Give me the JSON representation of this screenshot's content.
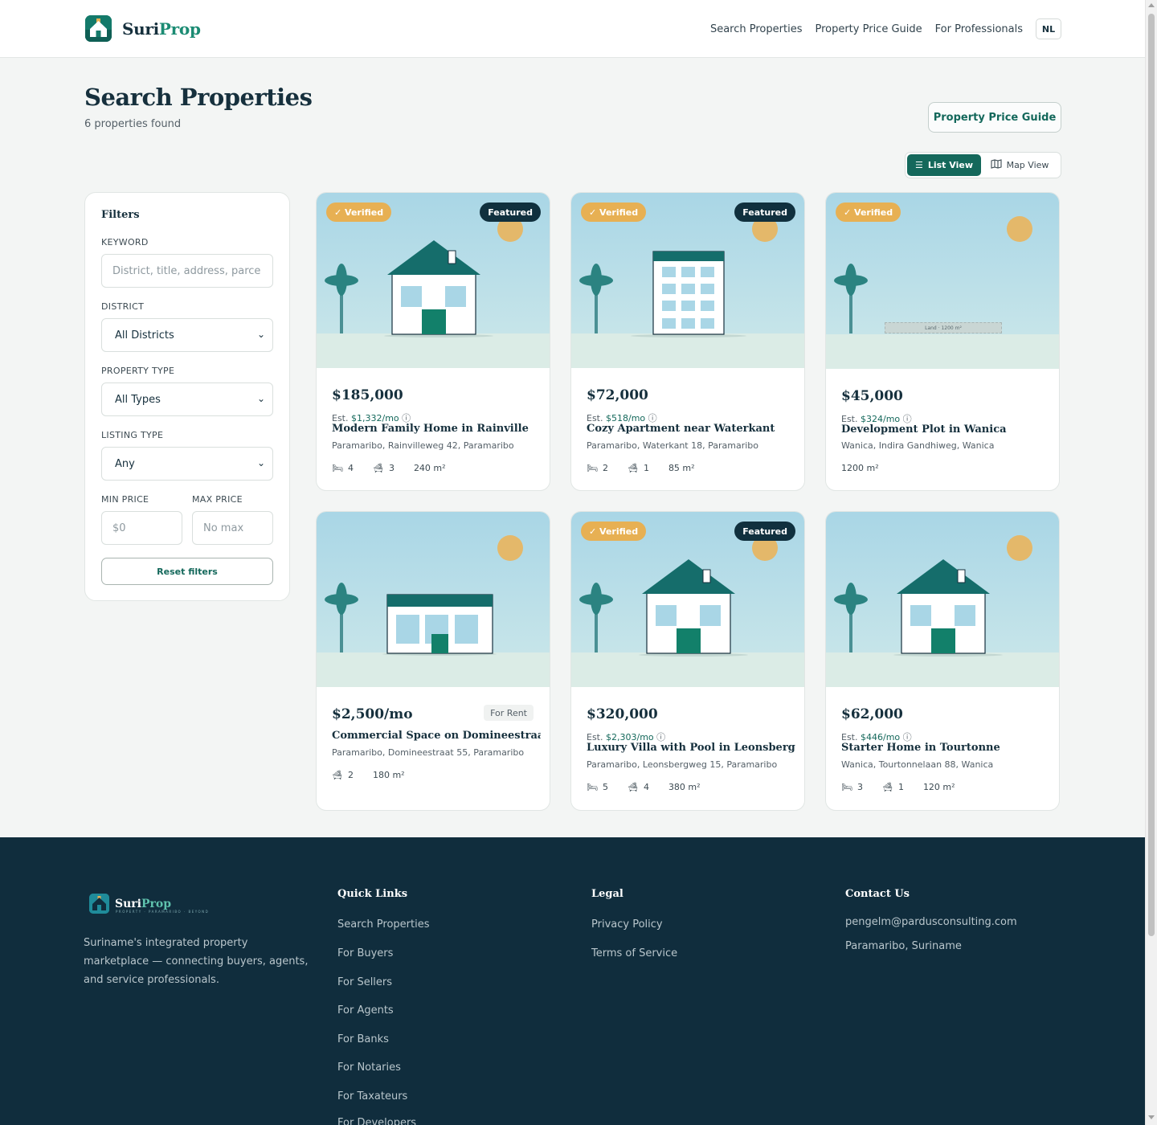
{
  "header": {
    "brand_part1": "Suri",
    "brand_part2": "Prop",
    "nav": [
      "Search Properties",
      "Property Price Guide",
      "For Professionals"
    ],
    "lang": "NL"
  },
  "page": {
    "title": "Search Properties",
    "count": "6 properties found",
    "guide_button": "Property Price Guide",
    "list_view": "List View",
    "map_view": "Map View"
  },
  "filters": {
    "title": "Filters",
    "keyword_label": "KEYWORD",
    "keyword_placeholder": "District, title, address, parce",
    "district_label": "DISTRICT",
    "district_value": "All Districts",
    "type_label": "PROPERTY TYPE",
    "type_value": "All Types",
    "listing_label": "LISTING TYPE",
    "listing_value": "Any",
    "min_label": "MIN PRICE",
    "min_placeholder": "$0",
    "max_label": "MAX PRICE",
    "max_placeholder": "No max",
    "reset": "Reset filters"
  },
  "badges": {
    "verified": "Verified",
    "featured": "Featured",
    "for_rent": "For Rent"
  },
  "est_prefix": "Est.",
  "cards": [
    {
      "price": "$185,000",
      "est": "$1,332/mo",
      "title": "Modern Family Home in Rainville",
      "address": "Paramaribo, Rainvilleweg 42, Paramaribo",
      "beds": "4",
      "baths": "3",
      "area": "240 m²"
    },
    {
      "price": "$72,000",
      "est": "$518/mo",
      "title": "Cozy Apartment near Waterkant",
      "address": "Paramaribo, Waterkant 18, Paramaribo",
      "beds": "2",
      "baths": "1",
      "area": "85 m²"
    },
    {
      "price": "$45,000",
      "est": "$324/mo",
      "title": "Development Plot in Wanica",
      "address": "Wanica, Indira Gandhiweg, Wanica",
      "area": "1200 m²",
      "land_label": "Land · 1200 m²"
    },
    {
      "price": "$2,500/mo",
      "title": "Commercial Space on Domineestraat",
      "address": "Paramaribo, Domineestraat 55, Paramaribo",
      "baths": "2",
      "area": "180 m²"
    },
    {
      "price": "$320,000",
      "est": "$2,303/mo",
      "title": "Luxury Villa with Pool in Leonsberg",
      "address": "Paramaribo, Leonsbergweg 15, Paramaribo",
      "beds": "5",
      "baths": "4",
      "area": "380 m²"
    },
    {
      "price": "$62,000",
      "est": "$446/mo",
      "title": "Starter Home in Tourtonne",
      "address": "Wanica, Tourtonnelaan 88, Wanica",
      "beds": "3",
      "baths": "1",
      "area": "120 m²"
    }
  ],
  "footer": {
    "brand_part1": "Suri",
    "brand_part2": "Prop",
    "tagline": "PROPERTY · PARAMARIBO · BEYOND",
    "description": "Suriname's integrated property marketplace — connecting buyers, agents, and service professionals.",
    "quick_links_title": "Quick Links",
    "quick_links": [
      "Search Properties",
      "For Buyers",
      "For Sellers",
      "For Agents",
      "For Banks",
      "For Notaries",
      "For Taxateurs",
      "For Developers"
    ],
    "legal_title": "Legal",
    "legal_links": [
      "Privacy Policy",
      "Terms of Service"
    ],
    "contact_title": "Contact Us",
    "contact_email": "pengelm@pardusconsulting.com",
    "contact_location": "Paramaribo, Suriname"
  },
  "colors": {
    "brand": "#14685b",
    "navy": "#10303e",
    "gold": "#e7b053"
  }
}
